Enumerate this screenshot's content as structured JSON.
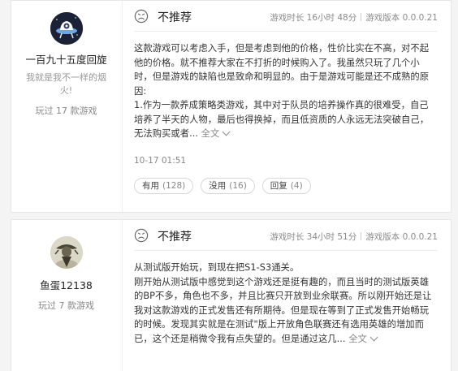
{
  "reviews": [
    {
      "user": {
        "name": "一百九十五度回旋",
        "signature": "我就是我不一样的烟火!",
        "played": "玩过 17 款游戏"
      },
      "recommend": "不推荐",
      "playtime": "游戏时长 16小时 48分",
      "version": "游戏版本 0.0.0.21",
      "text_lines": [
        "这款游戏可以考虑入手，但是考虑到他的价格，性价比实在不高，对不起",
        "他的价格。就不推荐大家在不打折的时候购入了。我虽然只玩了几个小",
        "时，但是游戏的缺陷也是致命和明显的。由于是游戏可能是还不成熟的原",
        "因:",
        "1.作为一款养成策略类游戏，其中对于队员的培养操作真的很难受，自己",
        "培养了半天的人物，最后也得换掉，而且低资质的人永远无法突破自己，",
        "无法购买或者..."
      ],
      "more_label": "全文",
      "date": "10-17 01:51",
      "votes": {
        "useful_label": "有用",
        "useful_count": "(128)",
        "useless_label": "没用",
        "useless_count": "(16)",
        "reply_label": "回复",
        "reply_count": "(4)"
      }
    },
    {
      "user": {
        "name": "鱼蛋12138",
        "played": "玩过 7 款游戏"
      },
      "recommend": "不推荐",
      "playtime": "游戏时长 34小时 51分",
      "version": "游戏版本 0.0.0.21",
      "text_lines": [
        "从测试版开始玩，到现在把S1-S3通关。",
        "刚开始从测试版中感觉到这个游戏还是挺有趣的，而且当时的测试版英雄",
        "的BP不多，角色也不多，并且比赛只开放到业余联赛。所以刚开始还是让",
        "我对这款游戏的正式发售还有所期待。但是现在等到了正式发售开始畅玩",
        "的时候。发现其实就是在测试\"版上开放角色联赛还有选用英雄的增加而",
        "已，这个还是稍微令我有点失望的。但是通过这几..."
      ],
      "more_label": "全文"
    }
  ],
  "icons": {
    "not_recommend": "sad-face-icon",
    "expand": "chevron-down-icon"
  }
}
